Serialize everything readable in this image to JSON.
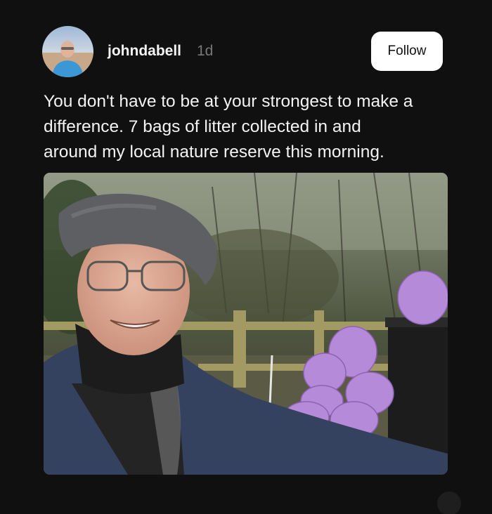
{
  "post": {
    "author": {
      "username": "johndabell",
      "posted_ago": "1d",
      "avatar": "avatar-photo"
    },
    "follow_label": "Follow",
    "caption_lines": [
      "You don't have to be at your strongest to make a",
      "difference. 7 bags of litter collected in and",
      "around my local nature reserve this morning."
    ],
    "image": "photo-man-selfie-with-litter-bags"
  },
  "colors": {
    "background": "#101010",
    "text": "#f3f3f3",
    "muted": "#777777",
    "button_bg": "#ffffff",
    "bag_purple": "#b58ad8"
  }
}
